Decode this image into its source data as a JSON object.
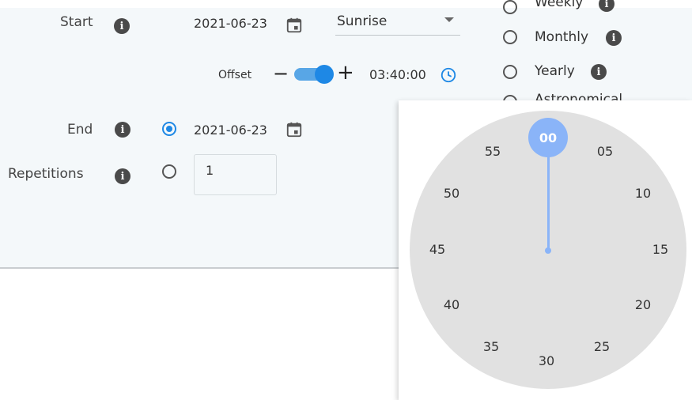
{
  "start": {
    "label": "Start",
    "date": "2021-06-23",
    "event": "Sunrise"
  },
  "offset": {
    "label": "Offset",
    "minus": "−",
    "plus": "+",
    "time": "03:40:00",
    "toggle_on": true
  },
  "end": {
    "label": "End",
    "date": "2021-06-23",
    "selected": true
  },
  "repetitions": {
    "label": "Repetitions",
    "value": "1",
    "selected": false
  },
  "frequency": {
    "options": [
      {
        "label": "Weekly"
      },
      {
        "label": "Monthly"
      },
      {
        "label": "Yearly"
      },
      {
        "label": "Astronomical"
      }
    ]
  },
  "clock": {
    "selected": "00",
    "numbers": [
      "00",
      "05",
      "10",
      "15",
      "20",
      "25",
      "30",
      "35",
      "40",
      "45",
      "50",
      "55"
    ]
  },
  "icons": {
    "info": "info-icon",
    "calendar": "calendar-icon",
    "clock": "clock-icon",
    "dropdown": "caret-down-icon"
  },
  "colors": {
    "accent": "#1e88e5",
    "dial_accent": "#8ab4f8",
    "dial_bg": "#e1e1e1"
  }
}
